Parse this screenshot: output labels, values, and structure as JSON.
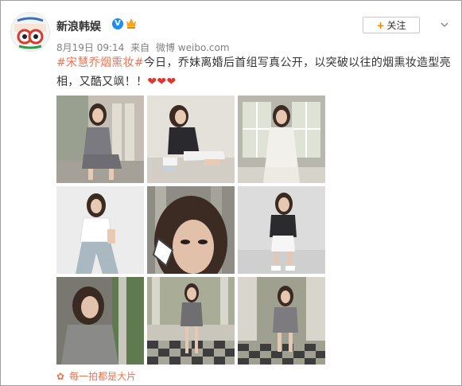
{
  "post": {
    "username": "新浪韩娱",
    "verified_glyph": "V",
    "timestamp": "8月19日 09:14",
    "source_prefix": "来自",
    "source": "微博 weibo.com",
    "follow_label": "关注",
    "follow_plus": "+",
    "hashtag": "#宋慧乔烟熏妆#",
    "body": "今日，乔妹离婚后首组写真公开，以突破以往的烟熏妆造型亮相，又酷又飒！！",
    "hearts": "❤❤❤"
  },
  "photos": [
    {
      "name": "photo-1",
      "scene": "seated-outdoor-plaid",
      "bg": "#b9b4ab"
    },
    {
      "name": "photo-2",
      "scene": "seated-leather-jacket",
      "bg": "#dcd8d1"
    },
    {
      "name": "photo-3",
      "scene": "window-white-outfit",
      "bg": "#a8a89c"
    },
    {
      "name": "photo-4",
      "scene": "standing-white-top",
      "bg": "#e8e8e8"
    },
    {
      "name": "photo-5",
      "scene": "closeup-portrait",
      "bg": "#8d8b85"
    },
    {
      "name": "photo-6",
      "scene": "standing-jacket-skirt",
      "bg": "#d8d8d8"
    },
    {
      "name": "photo-7",
      "scene": "portrait-grey-jacket",
      "bg": "#6f6f66"
    },
    {
      "name": "photo-8",
      "scene": "seated-checker-floor",
      "bg": "#a7a69b"
    },
    {
      "name": "photo-9",
      "scene": "leaning-checker-floor",
      "bg": "#9fa08f"
    }
  ],
  "footer": {
    "label": "每一拍都是大片"
  },
  "colors": {
    "hashtag": "#eb7350",
    "heart": "#e3332e",
    "verified": "#1e8cf0",
    "follow_plus": "#ff8200"
  }
}
